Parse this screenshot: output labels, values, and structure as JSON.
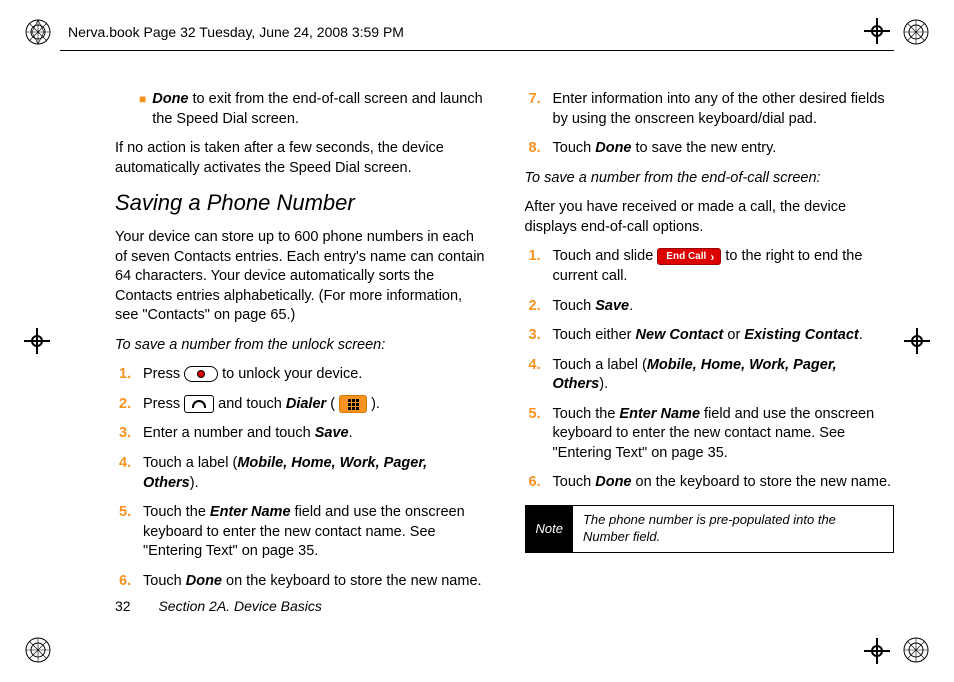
{
  "header": {
    "text": "Nerva.book  Page 32  Tuesday, June 24, 2008  3:59 PM"
  },
  "left": {
    "bullet_lead": "Done",
    "bullet_rest": " to exit from the end-of-call screen and launch the Speed Dial screen.",
    "para_after_bullet": "If no action is taken after a few seconds, the device automatically activates the Speed Dial screen.",
    "heading": "Saving a Phone Number",
    "intro": "Your device can store up to 600 phone numbers in each of seven Contacts entries. Each entry's name can contain 64 characters. Your device automatically sorts the Contacts entries alphabetically. (For more information, see \"Contacts\" on page 65.)",
    "subhead": "To save a number from the unlock screen:",
    "s1_a": "Press ",
    "s1_b": " to unlock your device.",
    "s2_a": "Press ",
    "s2_b": " and touch ",
    "s2_dialer": "Dialer",
    "s2_c": " (",
    "s2_d": ").",
    "s3_a": "Enter a number and touch ",
    "s3_save": "Save",
    "s3_b": ".",
    "s4_a": "Touch a label (",
    "s4_labels": "Mobile, Home, Work, Pager, Others",
    "s4_b": ").",
    "s5_a": "Touch the ",
    "s5_field": "Enter Name",
    "s5_b": " field and use the onscreen keyboard to enter the new contact name. See \"Entering Text\" on page 35.",
    "s6_a": "Touch ",
    "s6_done": "Done",
    "s6_b": " on the keyboard to store the new name."
  },
  "right": {
    "s7": "Enter information into any of the other desired fields by using the onscreen keyboard/dial pad.",
    "s8_a": "Touch ",
    "s8_done": "Done",
    "s8_b": " to save the new entry.",
    "subhead": "To save a number from the end-of-call screen:",
    "intro": "After you have received or made a call, the device displays end-of-call options.",
    "r1_a": "Touch and slide ",
    "r1_chip": "End Call",
    "r1_b": " to the right to end the current call.",
    "r2_a": "Touch ",
    "r2_save": "Save",
    "r2_b": ".",
    "r3_a": "Touch either ",
    "r3_new": "New Contact",
    "r3_or": " or ",
    "r3_ex": "Existing Contact",
    "r3_b": ".",
    "r4_a": "Touch a label (",
    "r4_labels": "Mobile, Home, Work, Pager, Others",
    "r4_b": ").",
    "r5_a": "Touch the ",
    "r5_field": "Enter Name",
    "r5_b": " field and use the onscreen keyboard to enter the new contact name. See \"Entering Text\" on page 35.",
    "r6_a": "Touch ",
    "r6_done": "Done",
    "r6_b": " on the keyboard to store the new name.",
    "note_label": "Note",
    "note_text": "The phone number is pre-populated into the Number field."
  },
  "footer": {
    "page": "32",
    "section": "Section 2A. Device Basics"
  }
}
